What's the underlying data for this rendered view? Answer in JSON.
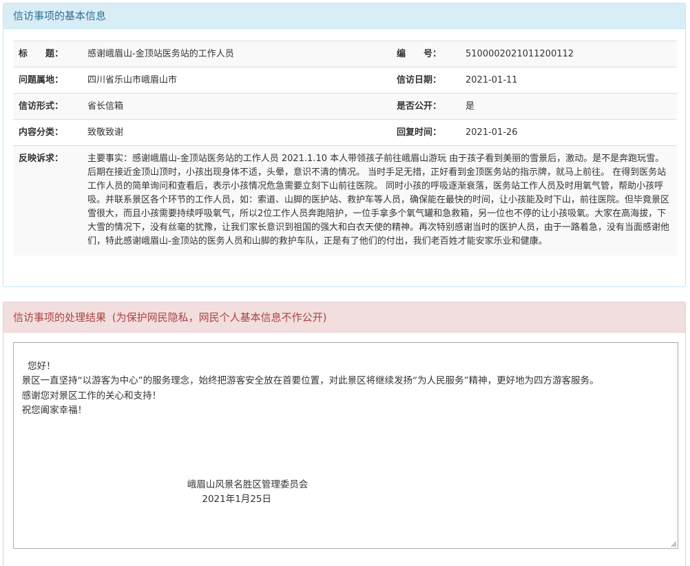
{
  "info_panel": {
    "title": "信访事项的基本信息",
    "rows": [
      {
        "label1": "标　　题：",
        "value1": "感谢峨眉山-金顶站医务站的工作人员",
        "label2": "编　　号：",
        "value2": "5100002021011200112"
      },
      {
        "label1": "问题属地：",
        "value1": "四川省乐山市峨眉山市",
        "label2": "信访日期：",
        "value2": "2021-01-11"
      },
      {
        "label1": "信访形式：",
        "value1": "省长信箱",
        "label2": "是否公开：",
        "value2": "是"
      },
      {
        "label1": "内容分类：",
        "value1": "致敬致谢",
        "label2": "回复时间：",
        "value2": "2021-01-26"
      }
    ],
    "complaint_label": "反映诉求：",
    "complaint_text": "主要事实：感谢峨眉山-金顶站医务站的工作人员 2021.1.10 本人带领孩子前往峨眉山游玩 由于孩子看到美丽的雪景后，激动。是不是奔跑玩雪。后期在接近金顶山顶时，小孩出现身体不适，头晕，意识不清的情况。 当时手足无措，正好看到金顶医务站的指示牌，就马上前往。 在得到医务站工作人员的简单询问和查看后，表示小孩情况危急需要立刻下山前往医院。 同时小孩的呼吸逐渐衰落，医务站工作人员及时用氧气管，帮助小孩呼吸。并联系景区各个环节的工作人员，如：索道、山脚的医护站、救护车等人员，确保能在最快的时间，让小孩能及时下山，前往医院。但毕竟景区雪很大，而且小孩需要持续呼吸氧气，所以2位工作人员奔跑陪护，一位手拿多个氧气罐和急救箱，另一位也不停的让小孩吸氧。大家在高海拔，下大雪的情况下，没有丝毫的犹豫，让我们家长意识到祖国的强大和白衣天使的精神。再次特别感谢当时的医护人员，由于一路着急，没有当面感谢他们，特此感谢峨眉山-金顶站的医务人员和山脚的救护车队，正是有了他们的付出，我们老百姓才能安家乐业和健康。"
  },
  "result_panel": {
    "title": "信访事项的处理结果",
    "note": "(为保护网民隐私，网民个人基本信息不作公开)",
    "reply_text": "您好！\n  景区一直坚持“以游客为中心”的服务理念，始终把游客安全放在首要位置，对此景区将继续发扬“为人民服务”精神，更好地为四方游客服务。\n  感谢您对景区工作的关心和支持！\n  祝您阖家幸福！\n\n\n\n\n                                                          峨眉山风景名胜区管理委员会\n                                                               2021年1月25日"
  }
}
